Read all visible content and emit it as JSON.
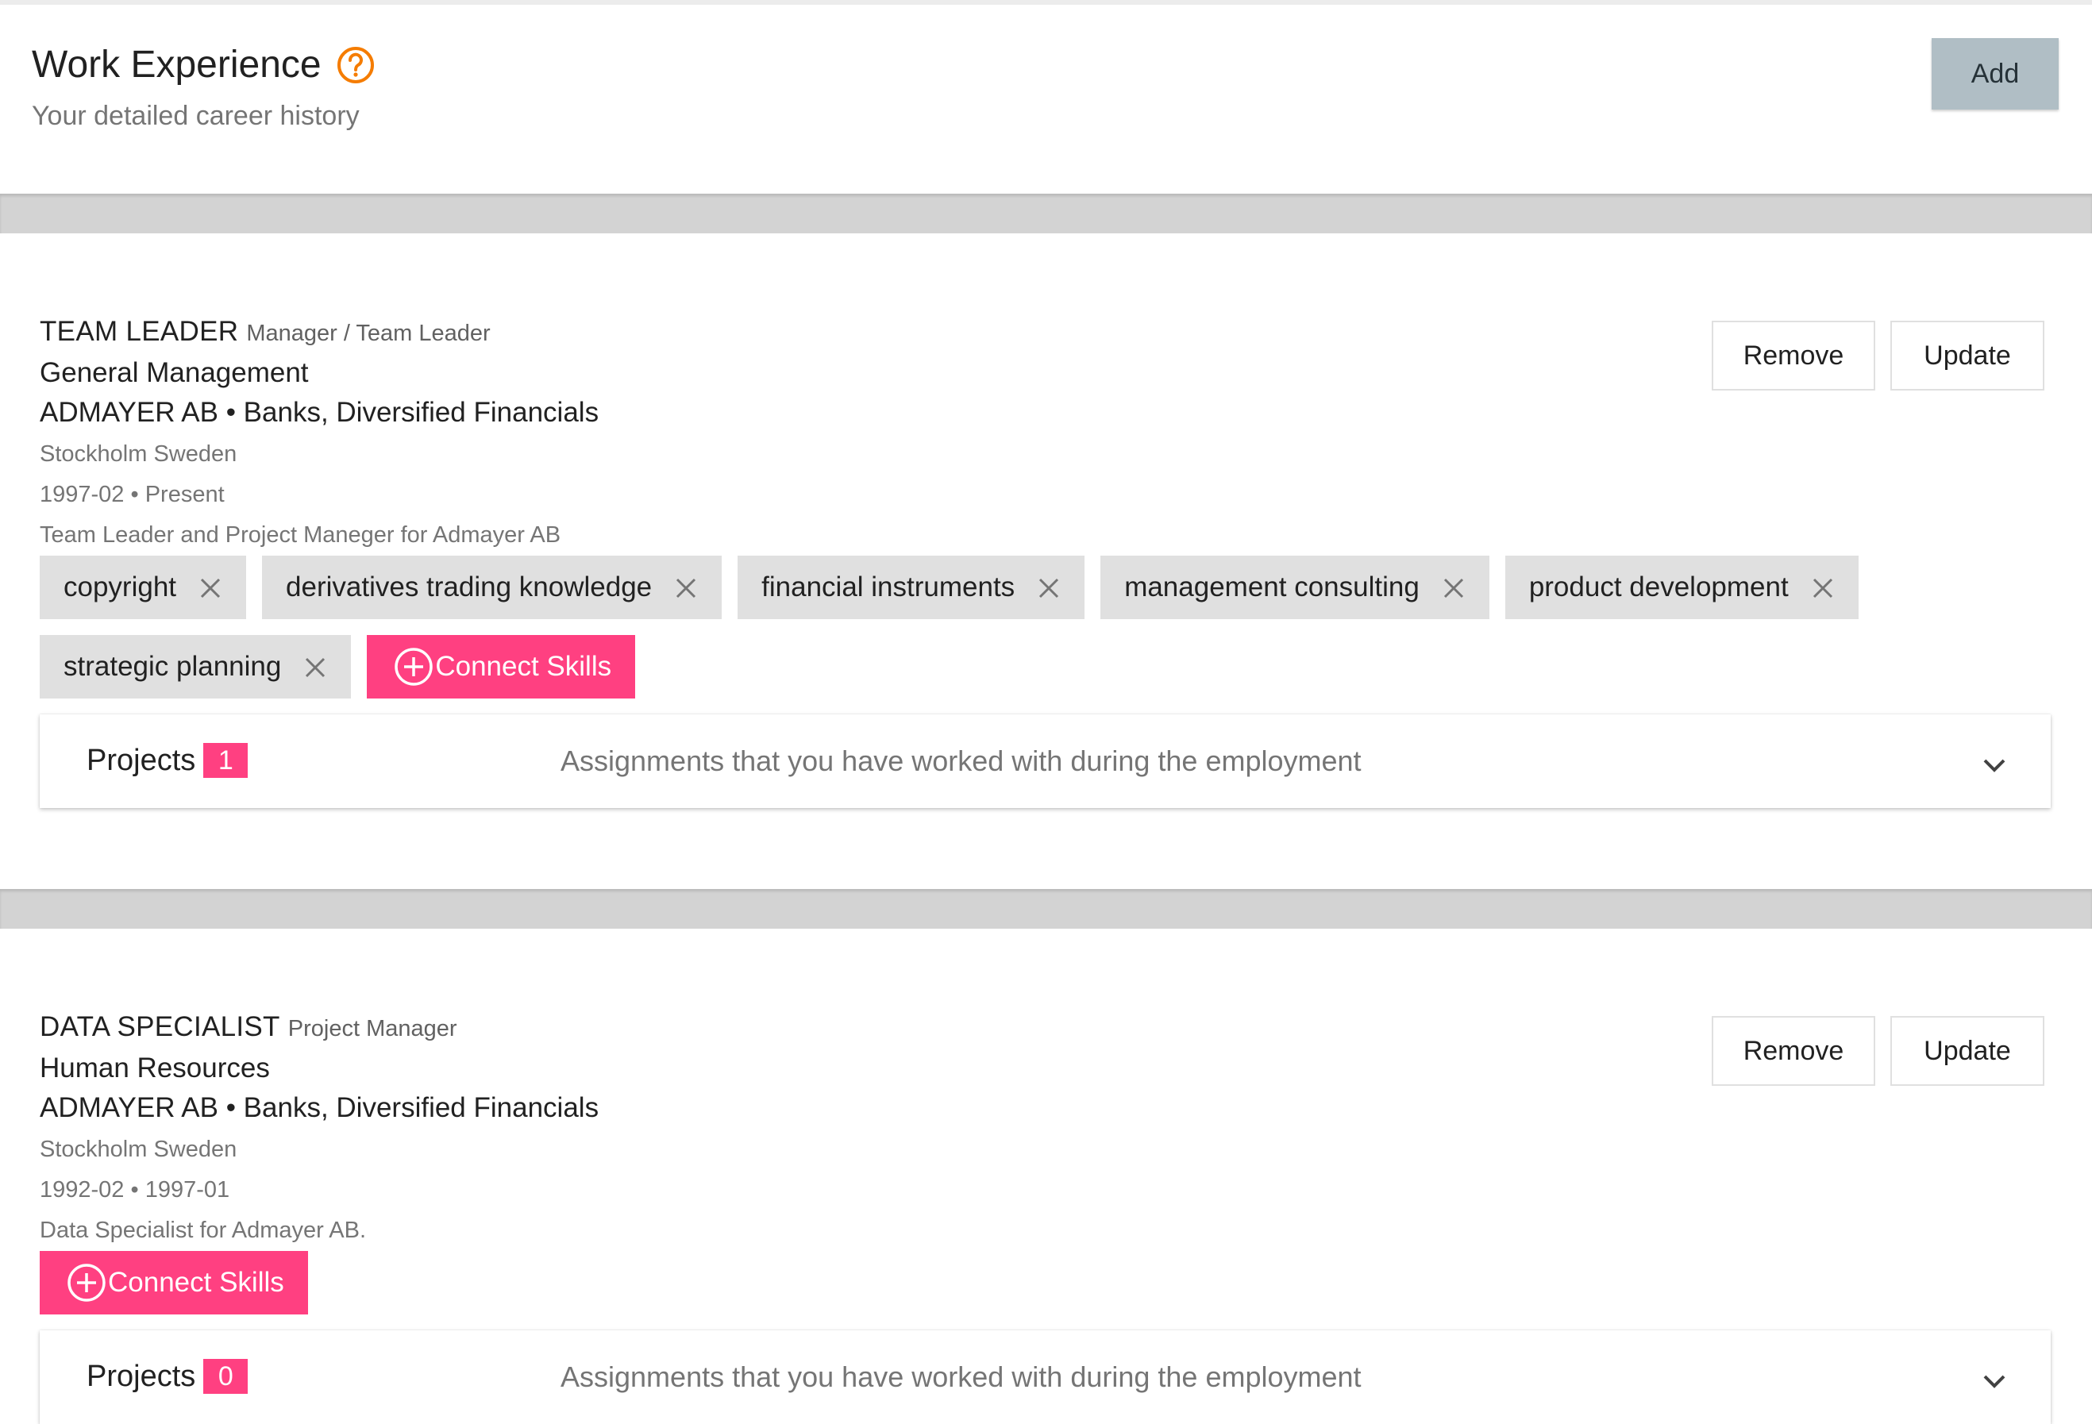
{
  "header": {
    "title": "Work Experience",
    "subtitle": "Your detailed career history",
    "add_label": "Add",
    "help_icon": "help-circle-icon",
    "accent_color": "#f57c00"
  },
  "experiences": [
    {
      "title": "TEAM LEADER",
      "role": "Manager / Team Leader",
      "department": "General Management",
      "company": "ADMAYER AB • Banks, Diversified Financials",
      "location": "Stockholm Sweden",
      "period": "1997-02 • Present",
      "description": "Team Leader and Project Maneger for Admayer AB",
      "skills": [
        "copyright",
        "derivatives trading knowledge",
        "financial instruments",
        "management consulting",
        "product development",
        "strategic planning"
      ],
      "remove_label": "Remove",
      "update_label": "Update",
      "connect_label": "Connect Skills",
      "projects_label": "Projects",
      "projects_count": "1",
      "projects_desc": "Assignments that you have worked with during the employment"
    },
    {
      "title": "DATA SPECIALIST",
      "role": "Project Manager",
      "department": "Human Resources",
      "company": "ADMAYER AB • Banks, Diversified Financials",
      "location": "Stockholm Sweden",
      "period": "1992-02 • 1997-01",
      "description": "Data Specialist for Admayer AB.",
      "skills": [],
      "remove_label": "Remove",
      "update_label": "Update",
      "connect_label": "Connect Skills",
      "projects_label": "Projects",
      "projects_count": "0",
      "projects_desc": "Assignments that you have worked with during the employment"
    }
  ],
  "colors": {
    "pink": "#ff4081",
    "chip_bg": "#e0e0e0",
    "add_bg": "#b0bec5",
    "separator": "#d3d3d3"
  }
}
